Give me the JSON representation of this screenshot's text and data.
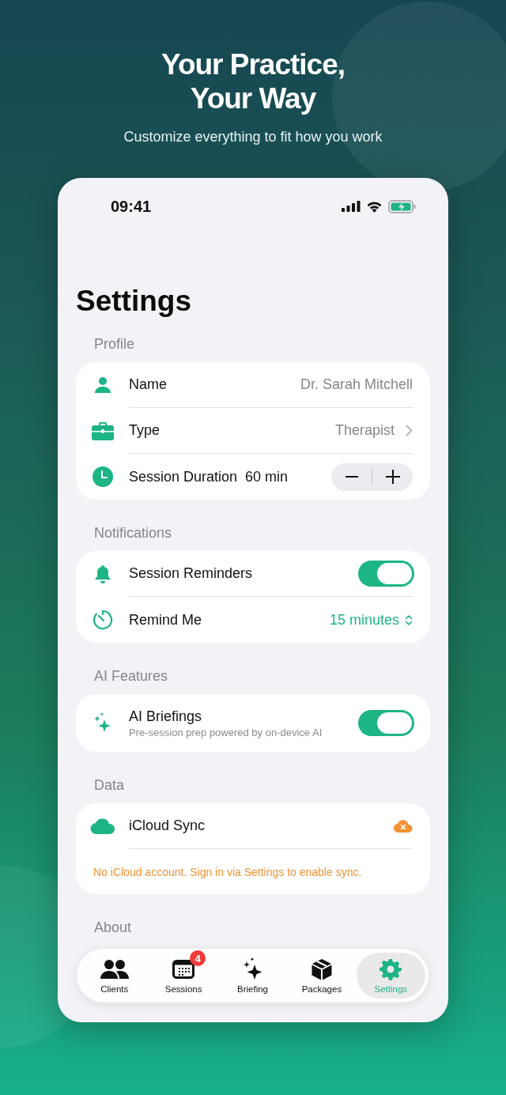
{
  "hero": {
    "title_lines": [
      "Your Practice,",
      "Your Way"
    ],
    "subtitle": "Customize everything to fit how you work"
  },
  "status_bar": {
    "time": "09:41"
  },
  "screen_title": "Settings",
  "sections": [
    {
      "header": "Profile",
      "rows": [
        {
          "kind": "value",
          "label": "Name",
          "value": "Dr. Sarah Mitchell"
        },
        {
          "kind": "link",
          "label": "Type",
          "value": "Therapist"
        },
        {
          "kind": "stepper",
          "label": "Session Duration",
          "value": "60 min"
        }
      ]
    },
    {
      "header": "Notifications",
      "rows": [
        {
          "kind": "toggle",
          "label": "Session Reminders",
          "on": true
        },
        {
          "kind": "picker",
          "label": "Remind Me",
          "value": "15 minutes"
        }
      ]
    },
    {
      "header": "AI Features",
      "rows": [
        {
          "kind": "toggle",
          "label": "AI Briefings",
          "subtitle": "Pre-session prep powered by on-device AI",
          "on": true
        }
      ]
    },
    {
      "header": "Data",
      "rows": [
        {
          "kind": "status",
          "label": "iCloud Sync"
        },
        {
          "kind": "note",
          "text": "No iCloud account. Sign in via Settings to enable sync."
        }
      ]
    },
    {
      "header": "About"
    }
  ],
  "tabs": [
    {
      "label": "Clients",
      "selected": false
    },
    {
      "label": "Sessions",
      "selected": false,
      "badge": "4"
    },
    {
      "label": "Briefing",
      "selected": false
    },
    {
      "label": "Packages",
      "selected": false
    },
    {
      "label": "Settings",
      "selected": true
    }
  ]
}
